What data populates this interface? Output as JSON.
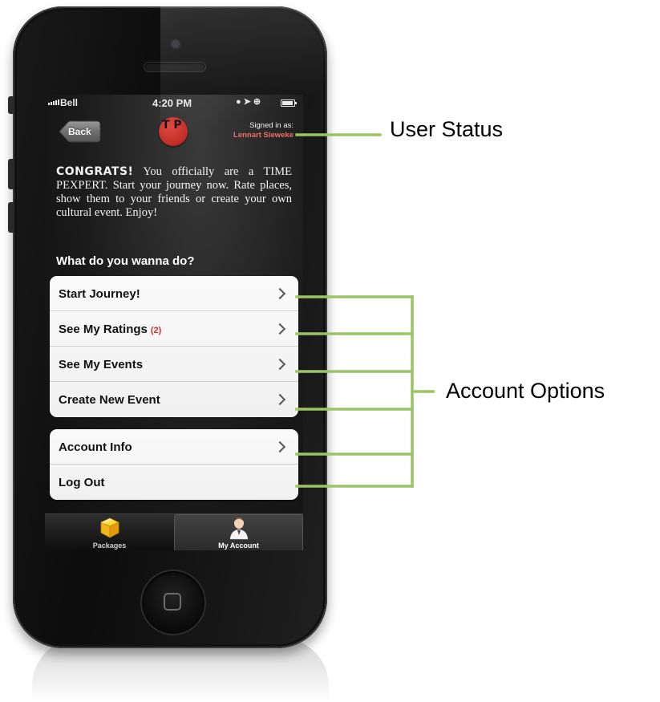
{
  "status_bar": {
    "carrier": "Bell",
    "time": "4:20 PM"
  },
  "nav": {
    "back_label": "Back",
    "logo_text": "T P",
    "signed_in_label": "Signed in as:",
    "signed_in_user": "Lennart Sieweke"
  },
  "intro": {
    "headline": "CONGRATS!",
    "text": "You officially are a TIME PEXPERT. Start your journey now. Rate places, show them to your friends or create your own cultural event. Enjoy!"
  },
  "section_heading": "What do you wanna do?",
  "menu_primary": [
    {
      "label": "Start Journey!",
      "badge": ""
    },
    {
      "label": "See My Ratings",
      "badge": "(2)"
    },
    {
      "label": "See My Events",
      "badge": ""
    },
    {
      "label": "Create New Event",
      "badge": ""
    }
  ],
  "menu_secondary": [
    {
      "label": "Account Info"
    },
    {
      "label": "Log Out"
    }
  ],
  "tab_bar": {
    "tabs": [
      {
        "label": "Packages",
        "icon": "package-box-icon",
        "selected": false
      },
      {
        "label": "My Account",
        "icon": "user-avatar-icon",
        "selected": true
      }
    ]
  },
  "callouts": {
    "user_status": "User Status",
    "account_options": "Account Options"
  },
  "colors": {
    "callout_line": "#9bc466",
    "accent_red": "#d4312b",
    "username": "#e86e6a"
  }
}
